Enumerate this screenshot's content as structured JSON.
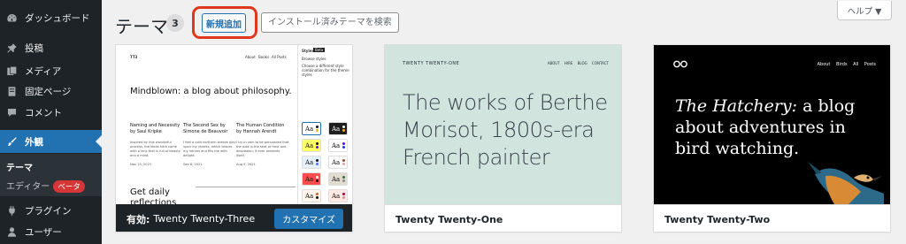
{
  "sidebar": {
    "items": [
      {
        "label": "ダッシュボード",
        "icon": "dashboard-icon"
      },
      {
        "label": "投稿",
        "icon": "pin-icon"
      },
      {
        "label": "メディア",
        "icon": "media-icon"
      },
      {
        "label": "固定ページ",
        "icon": "page-icon"
      },
      {
        "label": "コメント",
        "icon": "comment-icon"
      },
      {
        "label": "外観",
        "icon": "brush-icon"
      },
      {
        "label": "プラグイン",
        "icon": "plugin-icon"
      },
      {
        "label": "ユーザー",
        "icon": "user-icon"
      }
    ],
    "submenu": {
      "themes": "テーマ",
      "editor": "エディター",
      "beta": "ベータ"
    },
    "colors": {
      "bg": "#1d2327",
      "active": "#2271b1",
      "badge": "#d63638"
    }
  },
  "header": {
    "title": "テーマ",
    "count": "3",
    "add_new": "新規追加",
    "search_placeholder": "インストール済みテーマを検索...",
    "help": "ヘルプ ▼"
  },
  "themes": [
    {
      "name": "Twenty Twenty-Three",
      "active_label": "有効:",
      "customize": "カスタマイズ",
      "preview": {
        "site_title": "TT3",
        "nav": [
          "About",
          "Books",
          "All Posts"
        ],
        "headline": "Mindblown: a blog about philosophy.",
        "posts": [
          {
            "title": "Naming and Necessity by Saul Kripke",
            "body": "Inspired by this wonderful process, the ideas here come with a lens that is full of beauty and a mind.",
            "date": "Nov 15, 2021"
          },
          {
            "title": "The Second Sex by Simone de Beauvoir",
            "body": "I feel a cold northern breeze play upon my cheeks, which braces my nerves and fills me with delight.",
            "date": "Sep 8, 2021"
          },
          {
            "title": "The Human Condition by Hannah Arendt",
            "body": "I try in vain to be persuaded that the pole is the seat of frost and desolation; it ever presents itself.",
            "date": "Aug 9, 2021"
          }
        ],
        "daily": "Get daily reflections",
        "styles_title": "Styles",
        "styles_tag": "Beta",
        "browse": "Browse styles",
        "browse_desc": "Choose a different style combination for the theme styles",
        "swatch_label": "Aa"
      }
    },
    {
      "name": "Twenty Twenty-One",
      "preview": {
        "site_title": "TWENTY TWENTY-ONE",
        "nav": "ABOUT HIRE BLOG CONTACT",
        "headline": "The works of Berthe Morisot, 1800s-era French painter"
      }
    },
    {
      "name": "Twenty Twenty-Two",
      "preview": {
        "nav": "About Birds All Posts",
        "headline_italic": "The Hatchery:",
        "headline_rest": " a blog about adventures in bird watching."
      }
    }
  ]
}
